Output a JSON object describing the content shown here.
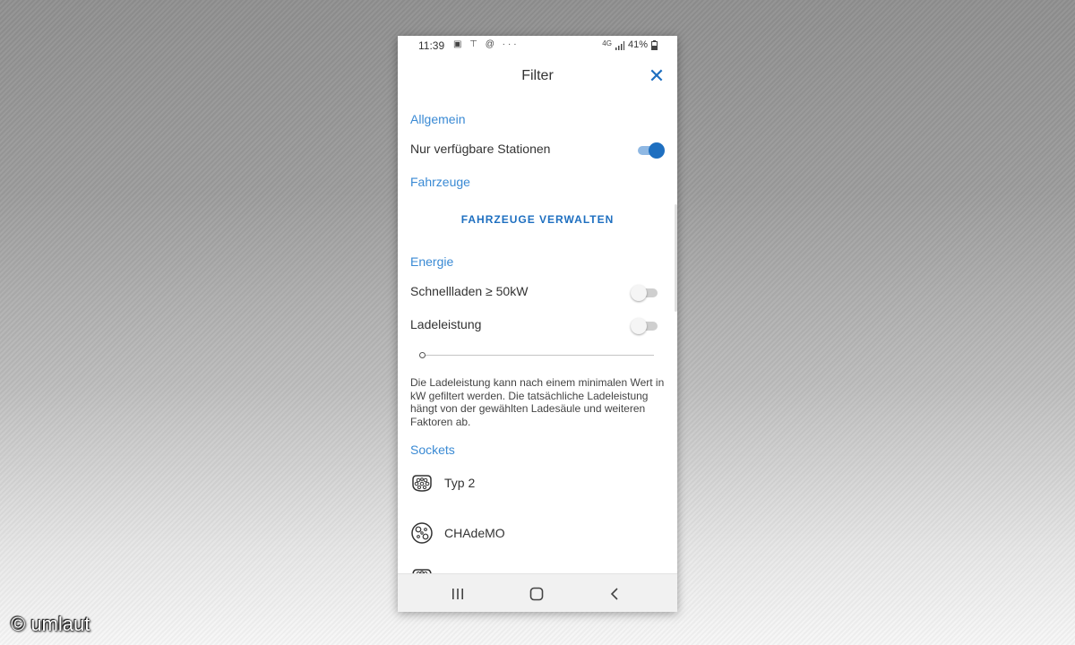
{
  "status_bar": {
    "time": "11:39",
    "icons": [
      "image-icon",
      "antenna-icon",
      "sync-icon",
      "more-dots-icon"
    ],
    "left_glyphs": "▣ ⊤ @ ···",
    "network": "4G",
    "battery": "41%"
  },
  "header": {
    "title": "Filter",
    "close_icon": "close-icon",
    "close_glyph": "✕"
  },
  "sections": {
    "general": {
      "title": "Allgemein",
      "available_label": "Nur verfügbare Stationen",
      "available_on": true
    },
    "vehicles": {
      "title": "Fahrzeuge",
      "manage_label": "FAHRZEUGE VERWALTEN"
    },
    "energy": {
      "title": "Energie",
      "fast_label": "Schnellladen ≥ 50kW",
      "fast_on": false,
      "power_label": "Ladeleistung",
      "power_on": false,
      "slider_value": 0,
      "description": "Die Ladeleistung kann nach einem minimalen Wert in kW gefiltert werden. Die tatsächliche Ladeleistung hängt von der gewählten Ladesäule und weiteren Faktoren ab."
    },
    "sockets": {
      "title": "Sockets",
      "items": [
        {
          "label": "Typ 2",
          "icon": "type2-socket-icon"
        },
        {
          "label": "CHAdeMO",
          "icon": "chademo-socket-icon"
        }
      ]
    }
  },
  "nav": {
    "recent_icon": "recent-apps-icon",
    "home_icon": "home-icon",
    "back_icon": "back-icon"
  },
  "watermark": "© umlaut",
  "colors": {
    "accent": "#1e6fc0",
    "section_title": "#3a8ad4",
    "toggle_on_track": "#8fb8e3",
    "text": "#333333"
  }
}
